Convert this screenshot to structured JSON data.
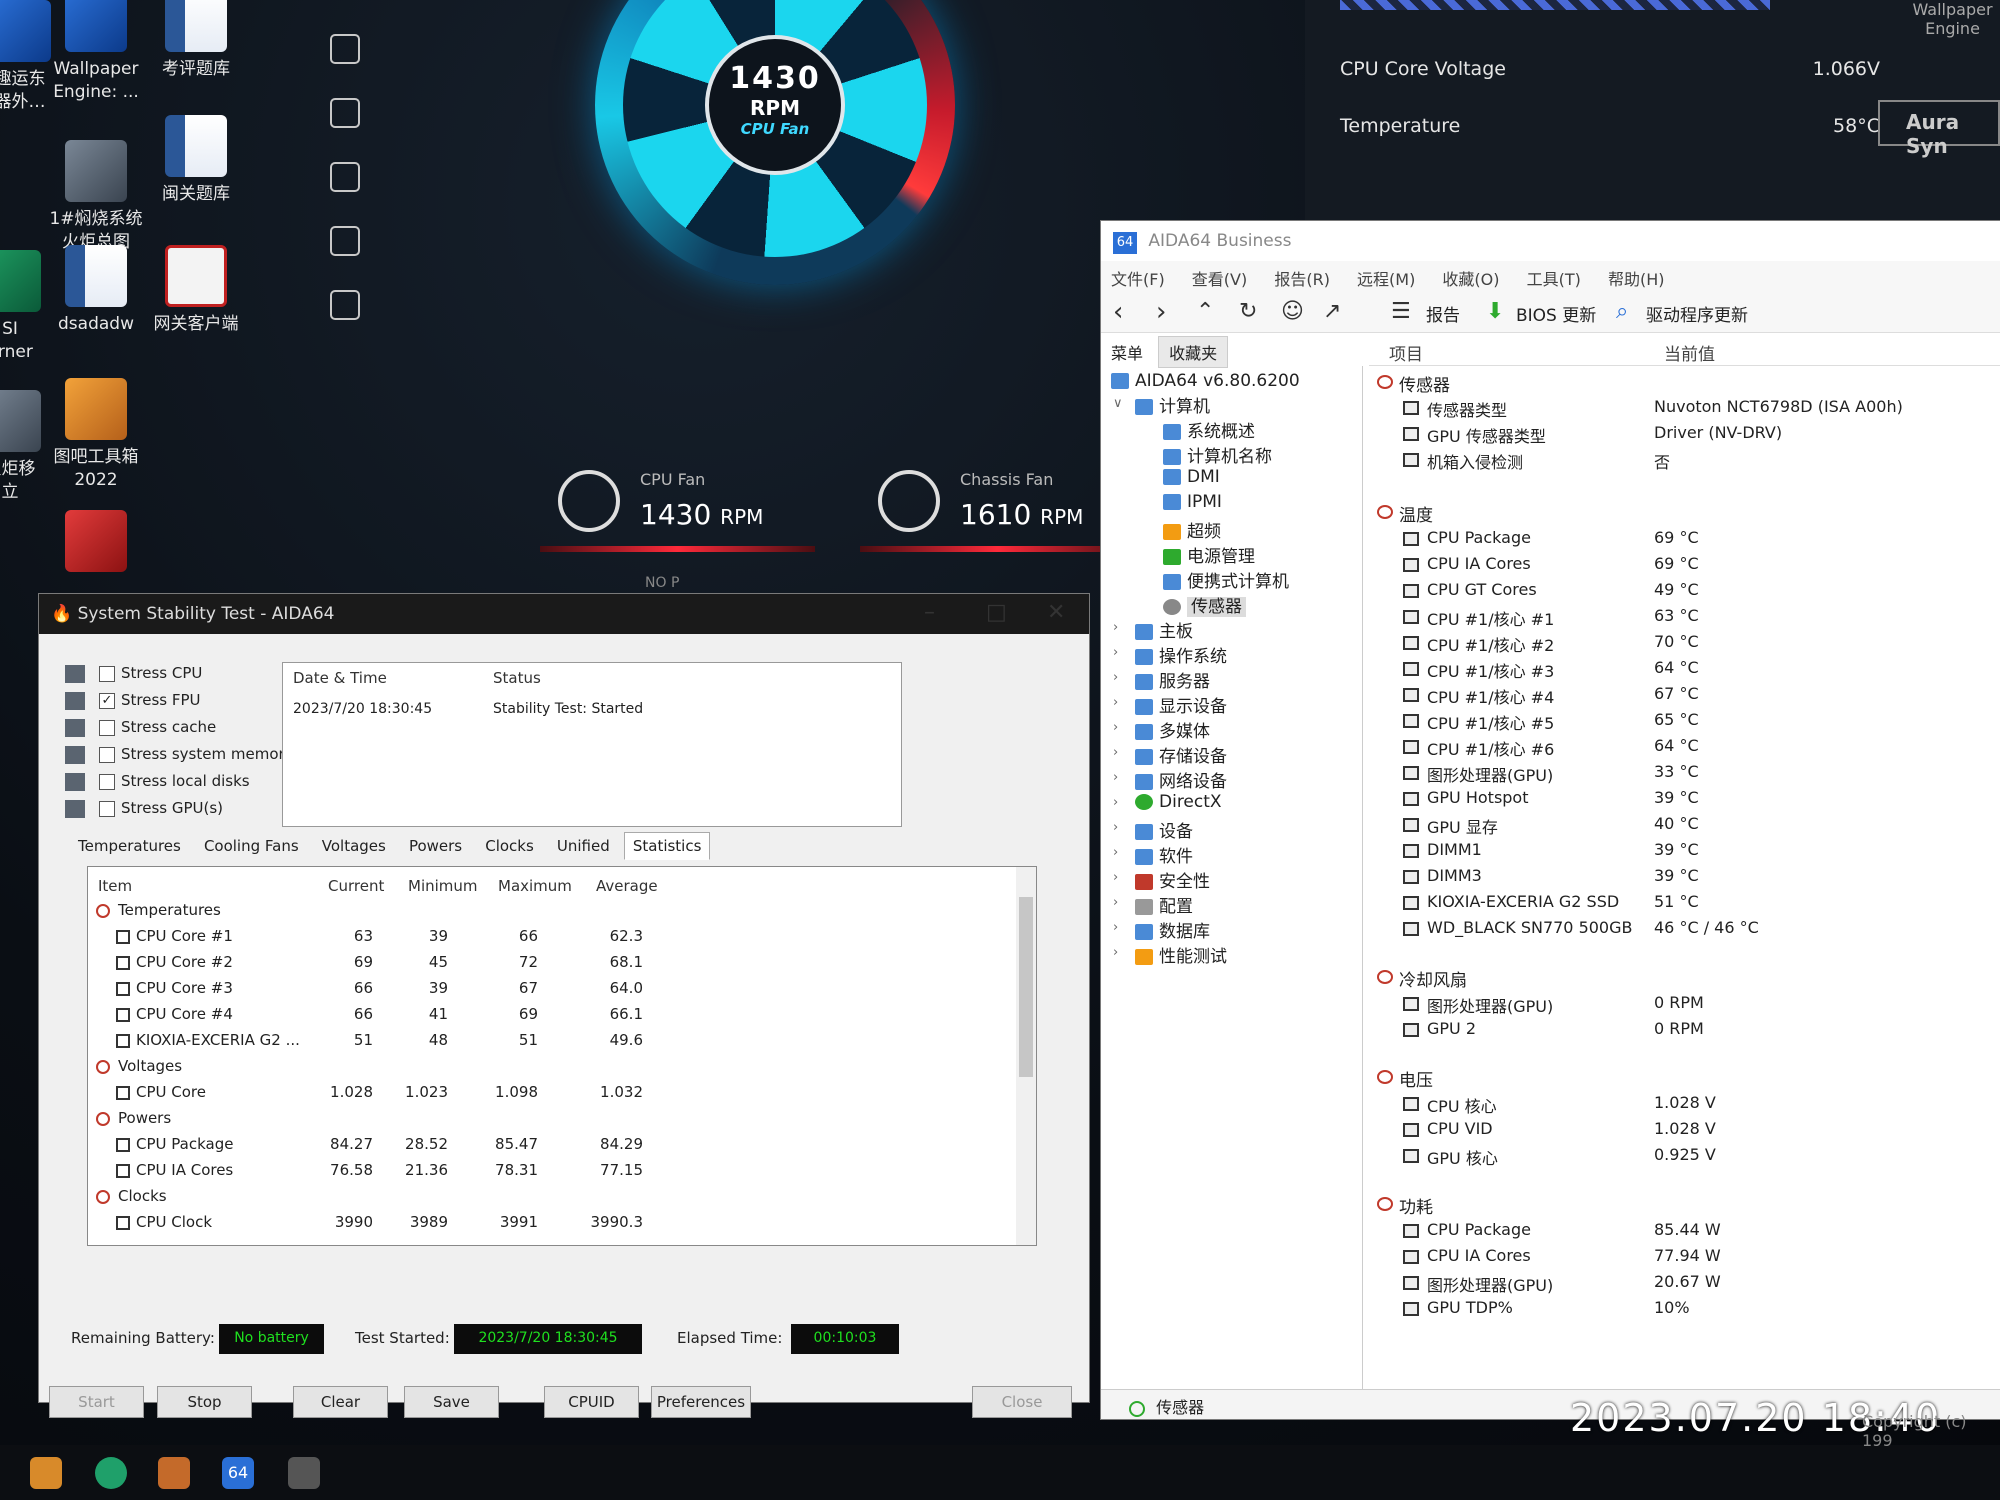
{
  "desktop": {
    "icons": [
      {
        "label": "趣运东\n器外…"
      },
      {
        "label": "Wallpaper\nEngine: ..."
      },
      {
        "label": "考评题库"
      },
      {
        "label": "1#焖烧系统\n火炬总图"
      },
      {
        "label": "闽关题库"
      },
      {
        "label": "dsadadw"
      },
      {
        "label": "网关客户端"
      },
      {
        "label": "SI\nurner"
      },
      {
        "label": "图吧工具箱\n2022"
      },
      {
        "label": "火炬移\n立"
      }
    ]
  },
  "armoury": {
    "fan_rpm": "1430",
    "fan_unit": "RPM",
    "fan_label": "CPU Fan",
    "cpu_fan": {
      "name": "CPU Fan",
      "value": "1430",
      "unit": "RPM"
    },
    "chassis_fan": {
      "name": "Chassis Fan",
      "value": "1610",
      "unit": "RPM"
    },
    "voltage": {
      "label": "CPU Core Voltage",
      "value": "1.066V"
    },
    "temperature": {
      "label": "Temperature",
      "value": "58°C"
    },
    "aura": "Aura Syn",
    "wallpaper_engine": "Wallpaper\nEngine",
    "no_label": "NO P"
  },
  "stability": {
    "title": "System Stability Test - AIDA64",
    "options": [
      {
        "label": "Stress CPU",
        "checked": false
      },
      {
        "label": "Stress FPU",
        "checked": true
      },
      {
        "label": "Stress cache",
        "checked": false
      },
      {
        "label": "Stress system memory",
        "checked": false
      },
      {
        "label": "Stress local disks",
        "checked": false
      },
      {
        "label": "Stress GPU(s)",
        "checked": false
      }
    ],
    "log": {
      "col_date": "Date & Time",
      "col_status": "Status",
      "date": "2023/7/20 18:30:45",
      "status": "Stability Test: Started"
    },
    "tabs": [
      "Temperatures",
      "Cooling Fans",
      "Voltages",
      "Powers",
      "Clocks",
      "Unified",
      "Statistics"
    ],
    "active_tab": "Statistics",
    "columns": [
      "Item",
      "Current",
      "Minimum",
      "Maximum",
      "Average"
    ],
    "rows": [
      {
        "group": true,
        "item": "Temperatures"
      },
      {
        "item": "CPU Core #1",
        "cur": "63",
        "min": "39",
        "max": "66",
        "avg": "62.3"
      },
      {
        "item": "CPU Core #2",
        "cur": "69",
        "min": "45",
        "max": "72",
        "avg": "68.1"
      },
      {
        "item": "CPU Core #3",
        "cur": "66",
        "min": "39",
        "max": "67",
        "avg": "64.0"
      },
      {
        "item": "CPU Core #4",
        "cur": "66",
        "min": "41",
        "max": "69",
        "avg": "66.1"
      },
      {
        "item": "KIOXIA-EXCERIA G2 ...",
        "cur": "51",
        "min": "48",
        "max": "51",
        "avg": "49.6"
      },
      {
        "group": true,
        "item": "Voltages"
      },
      {
        "item": "CPU Core",
        "cur": "1.028",
        "min": "1.023",
        "max": "1.098",
        "avg": "1.032"
      },
      {
        "group": true,
        "item": "Powers"
      },
      {
        "item": "CPU Package",
        "cur": "84.27",
        "min": "28.52",
        "max": "85.47",
        "avg": "84.29"
      },
      {
        "item": "CPU IA Cores",
        "cur": "76.58",
        "min": "21.36",
        "max": "78.31",
        "avg": "77.15"
      },
      {
        "group": true,
        "item": "Clocks"
      },
      {
        "item": "CPU Clock",
        "cur": "3990",
        "min": "3989",
        "max": "3991",
        "avg": "3990.3"
      }
    ],
    "battery_label": "Remaining Battery:",
    "battery_value": "No battery",
    "started_label": "Test Started:",
    "started_value": "2023/7/20 18:30:45",
    "elapsed_label": "Elapsed Time:",
    "elapsed_value": "00:10:03",
    "buttons": {
      "start": "Start",
      "stop": "Stop",
      "clear": "Clear",
      "save": "Save",
      "cpuid": "CPUID",
      "preferences": "Preferences",
      "close": "Close"
    }
  },
  "aida": {
    "title": "AIDA64 Business",
    "menu": [
      "文件(F)",
      "查看(V)",
      "报告(R)",
      "远程(M)",
      "收藏(O)",
      "工具(T)",
      "帮助(H)"
    ],
    "toolbar": {
      "report": "报告",
      "bios": "BIOS 更新",
      "driver": "驱动程序更新"
    },
    "left_tabs": [
      "菜单",
      "收藏夹"
    ],
    "tree": [
      {
        "label": "AIDA64 v6.80.6200",
        "level": 0
      },
      {
        "label": "计算机",
        "level": 1,
        "expanded": true
      },
      {
        "label": "系统概述",
        "level": 2
      },
      {
        "label": "计算机名称",
        "level": 2
      },
      {
        "label": "DMI",
        "level": 2
      },
      {
        "label": "IPMI",
        "level": 2
      },
      {
        "label": "超频",
        "level": 2
      },
      {
        "label": "电源管理",
        "level": 2
      },
      {
        "label": "便携式计算机",
        "level": 2
      },
      {
        "label": "传感器",
        "level": 2,
        "selected": true
      },
      {
        "label": "主板",
        "level": 1
      },
      {
        "label": "操作系统",
        "level": 1
      },
      {
        "label": "服务器",
        "level": 1
      },
      {
        "label": "显示设备",
        "level": 1
      },
      {
        "label": "多媒体",
        "level": 1
      },
      {
        "label": "存储设备",
        "level": 1
      },
      {
        "label": "网络设备",
        "level": 1
      },
      {
        "label": "DirectX",
        "level": 1
      },
      {
        "label": "设备",
        "level": 1
      },
      {
        "label": "软件",
        "level": 1
      },
      {
        "label": "安全性",
        "level": 1
      },
      {
        "label": "配置",
        "level": 1
      },
      {
        "label": "数据库",
        "level": 1
      },
      {
        "label": "性能测试",
        "level": 1
      }
    ],
    "col_item": "项目",
    "col_value": "当前值",
    "rows": [
      {
        "group": true,
        "item": "传感器"
      },
      {
        "item": "传感器类型",
        "val": "Nuvoton NCT6798D  (ISA A00h)"
      },
      {
        "item": "GPU 传感器类型",
        "val": "Driver  (NV-DRV)"
      },
      {
        "item": "机箱入侵检测",
        "val": "否"
      },
      {
        "gap": true
      },
      {
        "group": true,
        "item": "温度"
      },
      {
        "item": "CPU Package",
        "val": "69 °C"
      },
      {
        "item": "CPU IA Cores",
        "val": "69 °C"
      },
      {
        "item": "CPU GT Cores",
        "val": "49 °C"
      },
      {
        "item": "CPU #1/核心 #1",
        "val": "63 °C"
      },
      {
        "item": "CPU #1/核心 #2",
        "val": "70 °C"
      },
      {
        "item": "CPU #1/核心 #3",
        "val": "64 °C"
      },
      {
        "item": "CPU #1/核心 #4",
        "val": "67 °C"
      },
      {
        "item": "CPU #1/核心 #5",
        "val": "65 °C"
      },
      {
        "item": "CPU #1/核心 #6",
        "val": "64 °C"
      },
      {
        "item": "图形处理器(GPU)",
        "val": "33 °C"
      },
      {
        "item": "GPU Hotspot",
        "val": "39 °C"
      },
      {
        "item": "GPU 显存",
        "val": "40 °C"
      },
      {
        "item": "DIMM1",
        "val": "39 °C"
      },
      {
        "item": "DIMM3",
        "val": "39 °C"
      },
      {
        "item": "KIOXIA-EXCERIA G2 SSD",
        "val": "51 °C"
      },
      {
        "item": "WD_BLACK SN770 500GB",
        "val": "46 °C / 46 °C"
      },
      {
        "gap": true
      },
      {
        "group": true,
        "item": "冷却风扇"
      },
      {
        "item": "图形处理器(GPU)",
        "val": "0 RPM"
      },
      {
        "item": "GPU 2",
        "val": "0 RPM"
      },
      {
        "gap": true
      },
      {
        "group": true,
        "item": "电压"
      },
      {
        "item": "CPU 核心",
        "val": "1.028 V"
      },
      {
        "item": "CPU VID",
        "val": "1.028 V"
      },
      {
        "item": "GPU 核心",
        "val": "0.925 V"
      },
      {
        "gap": true
      },
      {
        "group": true,
        "item": "功耗"
      },
      {
        "item": "CPU Package",
        "val": "85.44 W"
      },
      {
        "item": "CPU IA Cores",
        "val": "77.94 W"
      },
      {
        "item": "图形处理器(GPU)",
        "val": "20.67 W"
      },
      {
        "item": "GPU TDP%",
        "val": "10%"
      }
    ],
    "status": "传感器"
  },
  "overlay": {
    "timestamp": "2023.07.20  18:40",
    "copyright": "Copyright (c) 199"
  }
}
